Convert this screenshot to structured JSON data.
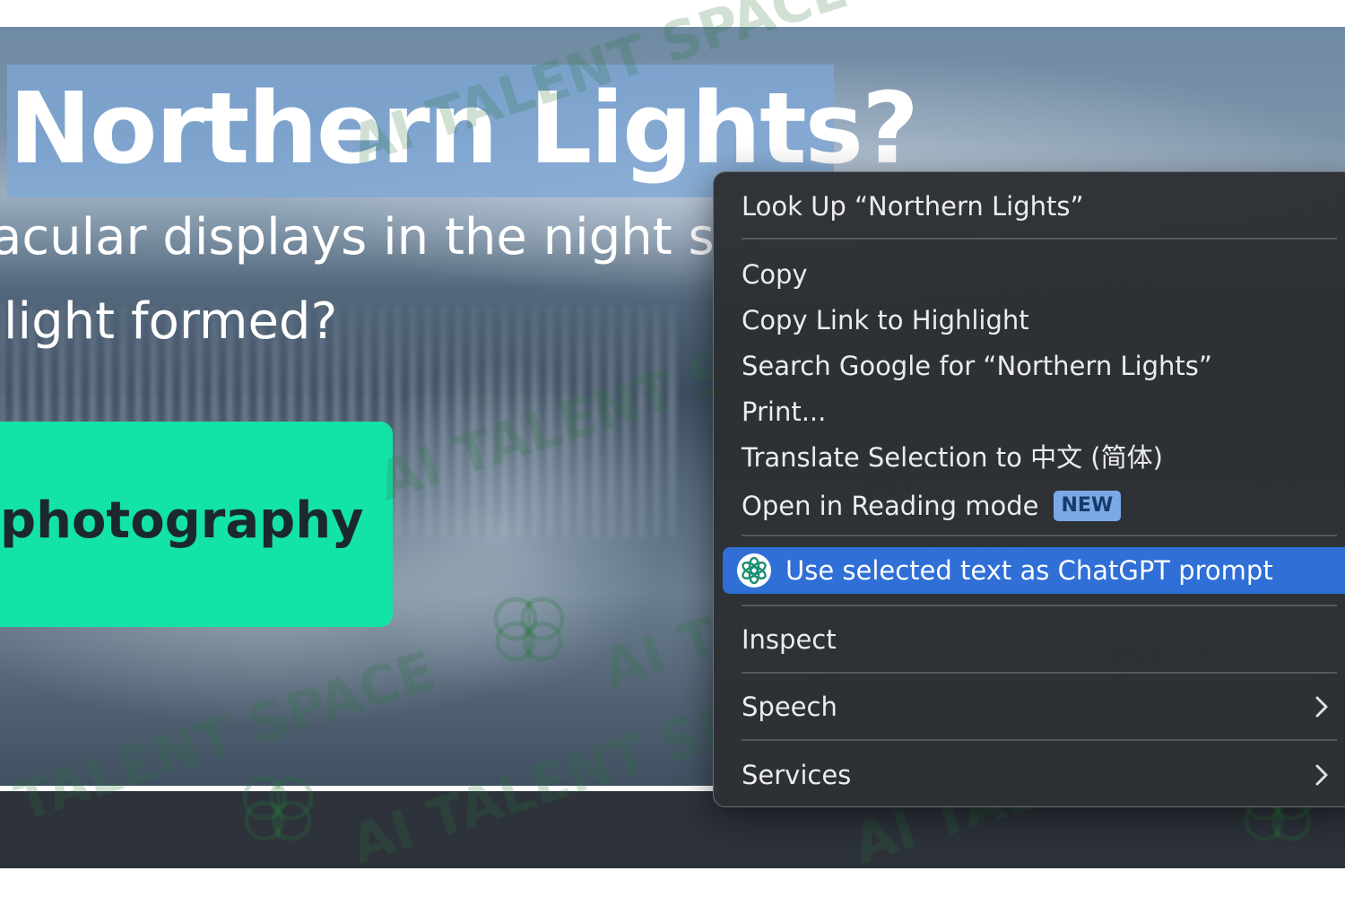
{
  "hero": {
    "title": "Northern Lights?",
    "line1": "acular displays in the night s",
    "line2": "light formed?",
    "cta_label": "photography"
  },
  "watermark": {
    "text": "AI TALENT SPACE"
  },
  "context_menu": {
    "look_up": "Look Up “Northern Lights”",
    "copy": "Copy",
    "copy_link": "Copy Link to Highlight",
    "search_google": "Search Google for “Northern Lights”",
    "print": "Print...",
    "translate": "Translate Selection to 中文 (简体)",
    "reading_mode": "Open in Reading mode",
    "reading_mode_badge": "NEW",
    "chatgpt_prompt": "Use selected text as ChatGPT prompt",
    "inspect": "Inspect",
    "speech": "Speech",
    "services": "Services"
  },
  "icons": {
    "chatgpt": "chatgpt-icon",
    "speech_submenu": "chevron-right-icon",
    "services_submenu": "chevron-right-icon"
  },
  "colors": {
    "selection": "#7da6d6",
    "cta": "#14e3a8",
    "menu_background": "#2c2f34",
    "menu_highlight": "#2f6fd6",
    "badge": "#7aa9e6"
  }
}
